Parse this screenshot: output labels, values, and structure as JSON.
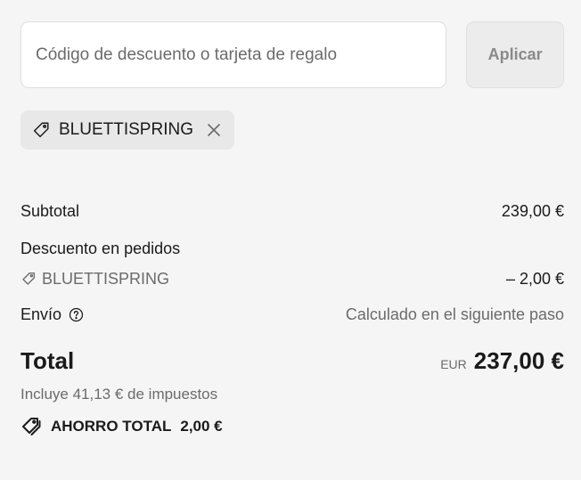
{
  "discount": {
    "placeholder": "Código de descuento o tarjeta de regalo",
    "value": "",
    "apply_label": "Aplicar"
  },
  "applied_code": {
    "code": "BLUETTISPRING",
    "icon": "tag-icon",
    "remove_icon": "close-icon"
  },
  "summary": {
    "subtotal_label": "Subtotal",
    "subtotal_value": "239,00 €",
    "discount_label": "Descuento en pedidos",
    "discount_code": "BLUETTISPRING",
    "discount_value": "– 2,00 €",
    "shipping_label": "Envío",
    "shipping_value": "Calculado en el siguiente paso",
    "total_label": "Total",
    "currency": "EUR",
    "total_value": "237,00 €",
    "tax_note": "Incluye 41,13 € de impuestos",
    "savings_label": "AHORRO TOTAL",
    "savings_value": "2,00 €"
  },
  "colors": {
    "background": "#f5f5f5",
    "text": "#1a1a1a",
    "muted": "#6b6b6b",
    "chip": "#e8e8e8"
  }
}
